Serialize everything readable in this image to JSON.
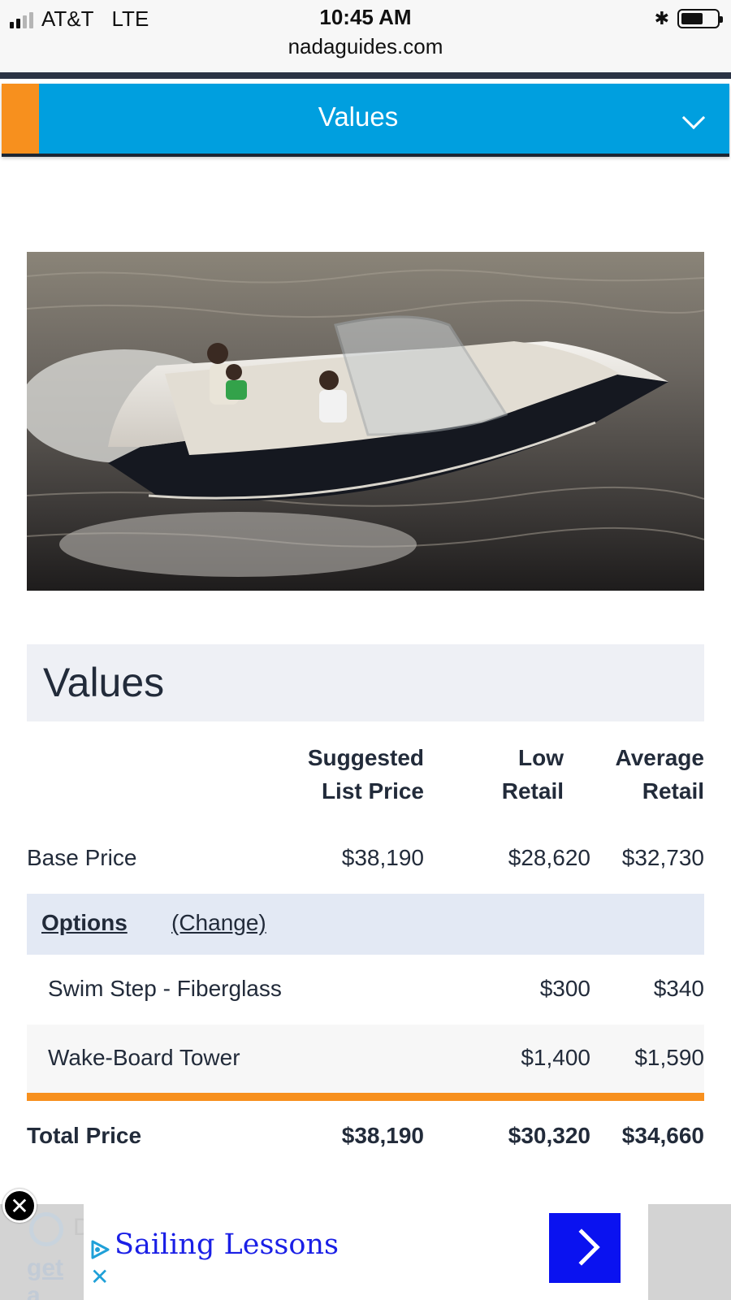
{
  "status_bar": {
    "carrier": "AT&T",
    "network": "LTE",
    "time": "10:45 AM",
    "url": "nadaguides.com",
    "bluetooth_icon": "bluetooth-icon",
    "battery_level": 0.55
  },
  "values_dropdown": {
    "label": "Values",
    "icon": "chevron-down-icon"
  },
  "section": {
    "title": "Values"
  },
  "table": {
    "columns": [
      {
        "line1": "Suggested",
        "line2": "List Price"
      },
      {
        "line1": "Low",
        "line2": "Retail"
      },
      {
        "line1": "Average",
        "line2": "Retail"
      }
    ],
    "base_row": {
      "name": "Base Price",
      "values": [
        "$38,190",
        "$28,620",
        "$32,730"
      ]
    },
    "options": {
      "title": "Options",
      "change_link": "(Change)"
    },
    "option_rows": [
      {
        "name": "Swim Step - Fiberglass",
        "values": [
          "",
          "$300",
          "$340"
        ]
      },
      {
        "name": "Wake-Board Tower",
        "values": [
          "",
          "$1,400",
          "$1,590"
        ]
      }
    ],
    "total_row": {
      "name": "Total Price",
      "values": [
        "$38,190",
        "$30,320",
        "$34,660"
      ]
    }
  },
  "ad": {
    "text": "Sailing Lessons",
    "ghost_text_d": "D",
    "ghost_text_get": "get a",
    "colors": {
      "text": "#1a1fe6",
      "button": "#0a12f0"
    }
  },
  "colors": {
    "accent_blue": "#009fdf",
    "accent_orange": "#f7901e",
    "header_bg": "#eef0f5",
    "options_bg": "#e3e9f4",
    "text": "#222b3a"
  }
}
